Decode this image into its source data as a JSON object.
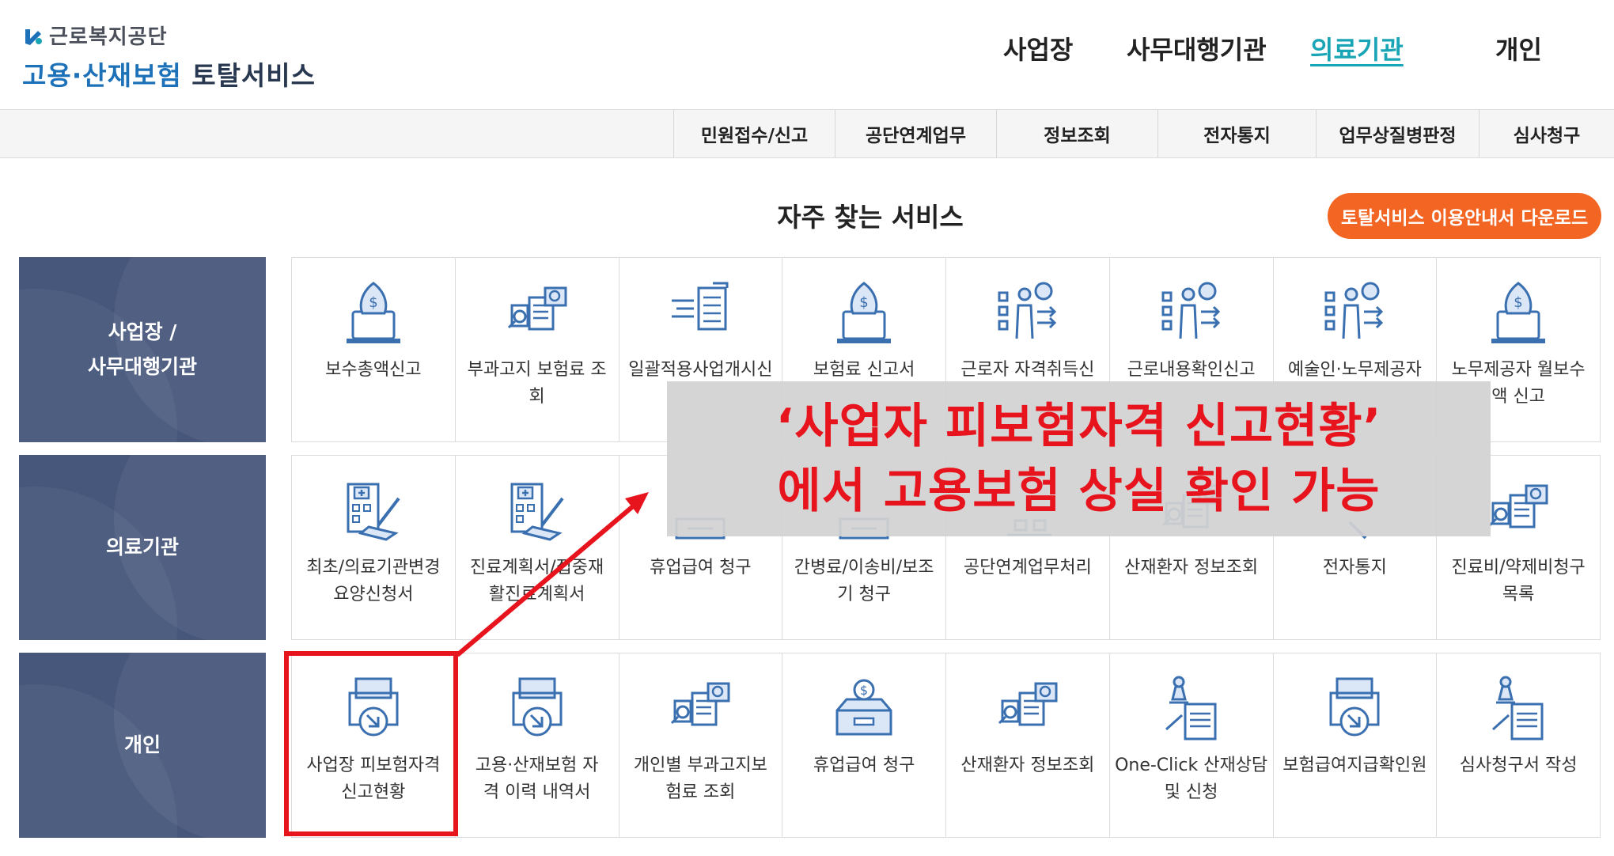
{
  "header": {
    "logo_top": "근로복지공단",
    "logo_bottom_blue": "고용·산재보험",
    "logo_bottom_dark": "토탈서비스",
    "nav": [
      "사업장",
      "사무대행기관",
      "의료기관",
      "개인"
    ],
    "active_nav": "의료기관"
  },
  "subnav": [
    "민원접수/신고",
    "공단연계업무",
    "정보조회",
    "전자통지",
    "업무상질병판정",
    "심사청구"
  ],
  "section": {
    "title": "자주 찾는 서비스",
    "download_label": "토탈서비스 이용안내서 다운로드"
  },
  "rows": [
    {
      "category": "사업장 /\n사무대행기관",
      "items": [
        {
          "label": "보수총액신고",
          "icon": "money-bag-laptop-icon"
        },
        {
          "label": "부과고지 보험료 조\n회",
          "icon": "document-search-icon"
        },
        {
          "label": "일괄적용사업개시신",
          "icon": "document-list-icon"
        },
        {
          "label": "보험료 신고서",
          "icon": "money-bag-laptop-icon"
        },
        {
          "label": "근로자 자격취득신",
          "icon": "presenter-board-icon"
        },
        {
          "label": "근로내용확인신고",
          "icon": "presenter-board-icon"
        },
        {
          "label": "예술인·노무제공자",
          "icon": "presenter-board-icon"
        },
        {
          "label": "노무제공자 월보수\n액 신고",
          "icon": "money-bag-laptop-icon"
        }
      ]
    },
    {
      "category": "의료기관",
      "items": [
        {
          "label": "최초/의료기관변경\n요양신청서",
          "icon": "hospital-pen-icon"
        },
        {
          "label": "진료계획서/집중재\n활진료계획서",
          "icon": "hospital-pen-icon"
        },
        {
          "label": "휴업급여 청구",
          "icon": "tray-icon"
        },
        {
          "label": "간병료/이송비/보조\n기 청구",
          "icon": "tray-icon"
        },
        {
          "label": "공단연계업무처리",
          "icon": "network-icon"
        },
        {
          "label": "산재환자 정보조회",
          "icon": "document-search-icon"
        },
        {
          "label": "전자통지",
          "icon": "pen-icon"
        },
        {
          "label": "진료비/약제비청구\n목록",
          "icon": "document-search-icon"
        }
      ]
    },
    {
      "category": "개인",
      "items": [
        {
          "label": "사업장 피보험자격\n신고현황",
          "icon": "printer-download-icon"
        },
        {
          "label": "고용·산재보험 자\n격 이력 내역서",
          "icon": "printer-download-icon"
        },
        {
          "label": "개인별 부과고지보\n험료 조회",
          "icon": "document-search-icon"
        },
        {
          "label": "휴업급여 청구",
          "icon": "coin-box-icon"
        },
        {
          "label": "산재환자 정보조회",
          "icon": "document-search-icon"
        },
        {
          "label": "One-Click 산재상담\n및 신청",
          "icon": "stamp-document-icon"
        },
        {
          "label": "보험급여지급확인원",
          "icon": "printer-download-icon"
        },
        {
          "label": "심사청구서 작성",
          "icon": "stamp-document-icon"
        }
      ]
    }
  ],
  "annotation": {
    "line1": "‘사업자 피보험자격 신고현황’",
    "line2": "에서 고용보험 상실 확인 가능"
  },
  "colors": {
    "accent": "#1aa5b6",
    "category_bg": "#47577b",
    "download_btn": "#f26522",
    "annotation_red": "#e8141d",
    "icon_blue": "#3a6fb0"
  }
}
